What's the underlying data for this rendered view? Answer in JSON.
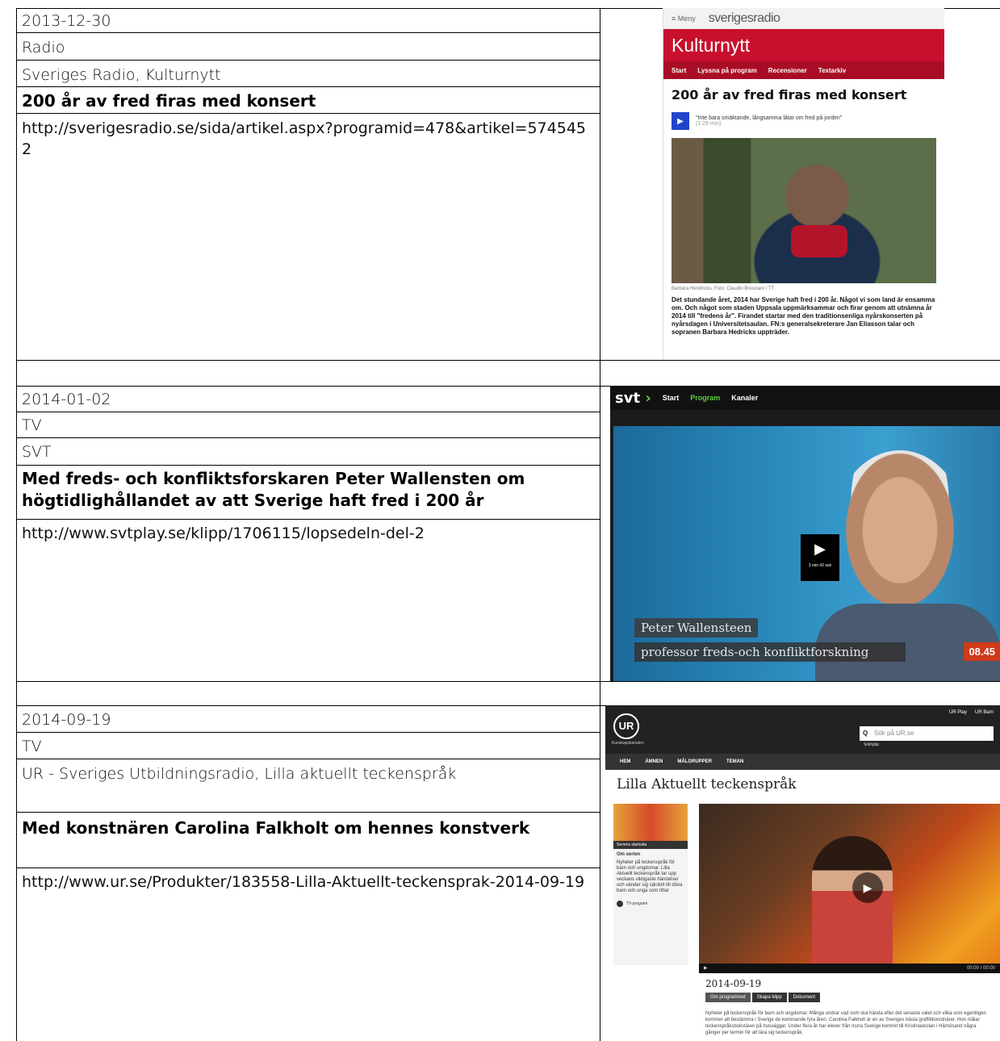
{
  "entries": [
    {
      "date": "2013-12-30",
      "media": "Radio",
      "source": "Sveriges Radio, Kulturnytt",
      "headline": "200 år av fred firas med konsert",
      "url": "http://sverigesradio.se/sida/artikel.aspx?programid=478&artikel=5745452"
    },
    {
      "date": "2014-01-02",
      "media": "TV",
      "source": "SVT",
      "headline": "Med freds- och konfliktsforskaren Peter Wallensten om högtidlighållandet av att Sverige haft fred i 200 år",
      "url": "http://www.svtplay.se/klipp/1706115/lopsedeln-del-2"
    },
    {
      "date": "2014-09-19",
      "media": "TV",
      "source": "UR - Sveriges Utbildningsradio, Lilla aktuellt teckenspråk",
      "headline": "Med konstnären Carolina Falkholt om hennes konstverk",
      "url": "http://www.ur.se/Produkter/183558-Lilla-Aktuellt-teckensprak-2014-09-19"
    }
  ],
  "sr_shot": {
    "menu": "≡ Meny",
    "logo": "sverigesradio",
    "program": "Kulturnytt",
    "nav": [
      "Start",
      "Lyssna på program",
      "Recensioner",
      "Textarkiv"
    ],
    "headline": "200 år av fred firas med konsert",
    "player_text": "\"Inte bara smäktande, långsamma låtar om fred på jorden\"",
    "player_duration": "(1:29 min)",
    "caption": "Barbara Hendricks. Foto: Claudio Bresciani / TT",
    "body": "Det stundande året, 2014 har Sverige haft fred i 200 år. Något vi som land är ensamma om. Och något som staden Uppsala uppmärksammar och firar genom att utnämna år 2014 till \"fredens år\". Firandet startar med den traditionsenliga nyårskonserten på nyårsdagen i Universitetsaulan. FN:s generalsekreterare Jan Eliasson talar och sopranen Barbara Hedricks uppträder."
  },
  "svt_shot": {
    "logo": "svt",
    "nav": [
      "Start",
      "Program",
      "Kanaler"
    ],
    "duration": "3 min 42 sek",
    "name": "Peter Wallensteen",
    "title": "professor freds-och konfliktforskning",
    "time": "08.45"
  },
  "ur_shot": {
    "logo": "UR",
    "logo_sub": "Kunskapskanalen",
    "top_links": [
      "UR Play",
      "UR Barn"
    ],
    "search_placeholder": "Sök på UR.se",
    "search_help": "Sökhjälp",
    "nav": [
      "HEM",
      "ÄMNEN",
      "MÅLGRUPPER",
      "TEMAN"
    ],
    "title": "Lilla Aktuellt teckenspråk",
    "series_start": "Seriens startsida",
    "about_heading": "Om serien",
    "about_text": "Nyheter på teckenspråk för barn och ungdomar. Lilla Aktuellt teckenspråk tar upp veckans viktigaste händelser och vänder sig särskilt till döva barn och unga som tittar",
    "tv_program": "TV-program",
    "video_time": "00:00 / 00:00",
    "date": "2014-09-19",
    "tabs": [
      "Om programmet",
      "Skapa klipp",
      "Dokument"
    ],
    "description": "Nyheter på teckenspråk för barn och ungdomar. Många undrar vad som ska hända efter det senaste valet och vilka som egentligen kommer att bestämma i Sverige de kommande fyra åren. Carolina Falkholt är en av Sveriges bästa graffitikonstnärer. Hon målar teckenspråksbokstäver på husväggar. Under flera år har elever från norra Sverige kommit till Kristinaskolan i Härnösand några gånger per termin för att lära sig teckenspråk."
  }
}
